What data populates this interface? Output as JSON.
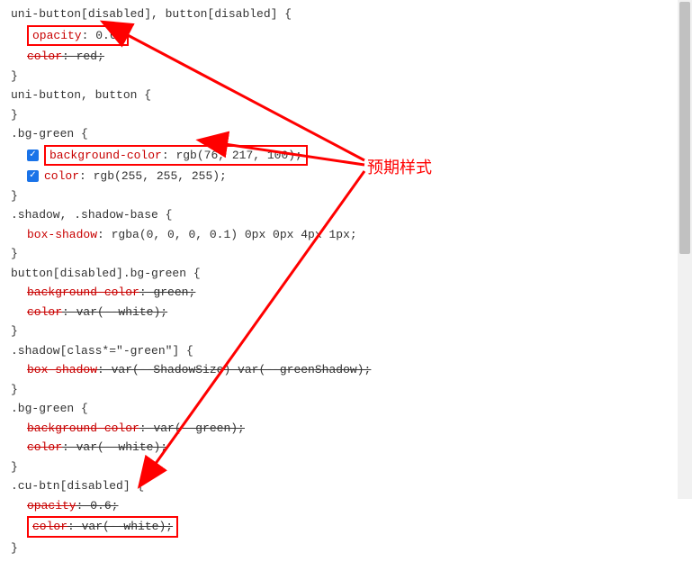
{
  "annotation_label": "预期样式",
  "rules": [
    {
      "selector": "uni-button[disabled], button[disabled] {",
      "decls": [
        {
          "prop": "opacity",
          "val": "0.6;",
          "strike": false,
          "boxed": true,
          "checkbox": false,
          "checked": false
        },
        {
          "prop": "color",
          "val": "red;",
          "strike": true,
          "boxed": false,
          "checkbox": false,
          "checked": false
        }
      ]
    },
    {
      "selector": "uni-button, button {",
      "decls": []
    },
    {
      "selector": ".bg-green {",
      "decls": [
        {
          "prop": "background-color",
          "val": "rgb(76, 217, 100);",
          "strike": false,
          "boxed": true,
          "checkbox": true,
          "checked": true
        },
        {
          "prop": "color",
          "val": "rgb(255, 255, 255);",
          "strike": false,
          "boxed": false,
          "checkbox": true,
          "checked": true
        }
      ]
    },
    {
      "selector": ".shadow, .shadow-base {",
      "decls": [
        {
          "prop": "box-shadow",
          "val": "rgba(0, 0, 0, 0.1) 0px 0px 4px 1px;",
          "strike": false,
          "boxed": false,
          "checkbox": false,
          "checked": false
        }
      ]
    },
    {
      "selector": "button[disabled].bg-green {",
      "decls": [
        {
          "prop": "background-color",
          "val": "green;",
          "strike": true,
          "boxed": false,
          "checkbox": false,
          "checked": false
        },
        {
          "prop": "color",
          "val": "var(--white);",
          "strike": true,
          "boxed": false,
          "checkbox": false,
          "checked": false
        }
      ]
    },
    {
      "selector": ".shadow[class*=\"-green\"] {",
      "decls": [
        {
          "prop": "box-shadow",
          "val": "var(--ShadowSize) var(--greenShadow);",
          "strike": true,
          "boxed": false,
          "checkbox": false,
          "checked": false
        }
      ]
    },
    {
      "selector": ".bg-green {",
      "decls": [
        {
          "prop": "background-color",
          "val": "var(--green);",
          "strike": true,
          "boxed": false,
          "checkbox": false,
          "checked": false
        },
        {
          "prop": "color",
          "val": "var(--white);",
          "strike": true,
          "boxed": false,
          "checkbox": false,
          "checked": false
        }
      ]
    },
    {
      "selector": ".cu-btn[disabled] {",
      "decls": [
        {
          "prop": "opacity",
          "val": "0.6;",
          "strike": true,
          "boxed": false,
          "checkbox": false,
          "checked": false
        },
        {
          "prop": "color",
          "val": "var(--white);",
          "strike": true,
          "boxed": true,
          "checkbox": false,
          "checked": false
        }
      ]
    }
  ]
}
